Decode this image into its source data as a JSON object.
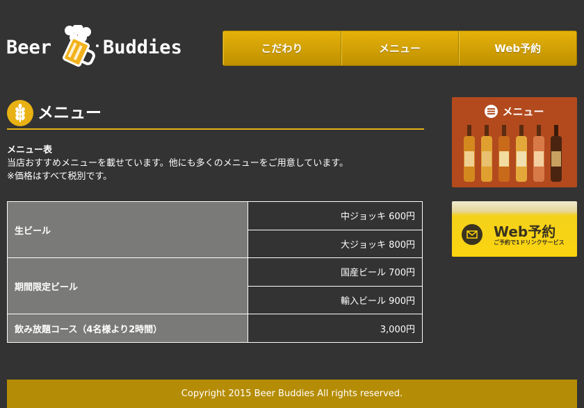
{
  "header": {
    "logo_left": "Beer",
    "logo_right": "Buddies",
    "nav": [
      {
        "label": "こだわり"
      },
      {
        "label": "メニュー"
      },
      {
        "label": "Web予約"
      }
    ]
  },
  "main": {
    "title": "メニュー",
    "subheading": "メニュー表",
    "intro_line1": "当店おすすめメニューを載せています。他にも多くのメニューをご用意しています。",
    "intro_line2": "※価格はすべて税別です。",
    "table": {
      "rows": [
        {
          "category": "生ビール",
          "item": "中ジョッキ 600円"
        },
        {
          "item": "大ジョッキ 800円"
        },
        {
          "category": "期間限定ビール",
          "item": "国産ビール 700円"
        },
        {
          "item": "輸入ビール 900円"
        },
        {
          "category": "飲み放題コース（4名様より2時間）",
          "item": "3,000円"
        }
      ]
    }
  },
  "sidebar": {
    "menu_banner_label": "メニュー",
    "web_banner_title": "Web予約",
    "web_banner_sub": "ご予約で1ドリンクサービス"
  },
  "footer": {
    "copyright": "Copyright 2015 Beer Buddies All rights reserved."
  },
  "colors": {
    "background": "#333333",
    "accent": "#e6b316",
    "footer": "#b58c05",
    "table_category": "#7a7a78",
    "menu_banner": "#b24a1e",
    "web_banner": "#fbd40f"
  },
  "icons": [
    "beer-mug-icon",
    "wheat-icon",
    "list-icon",
    "bottle-icon",
    "mail-icon"
  ]
}
